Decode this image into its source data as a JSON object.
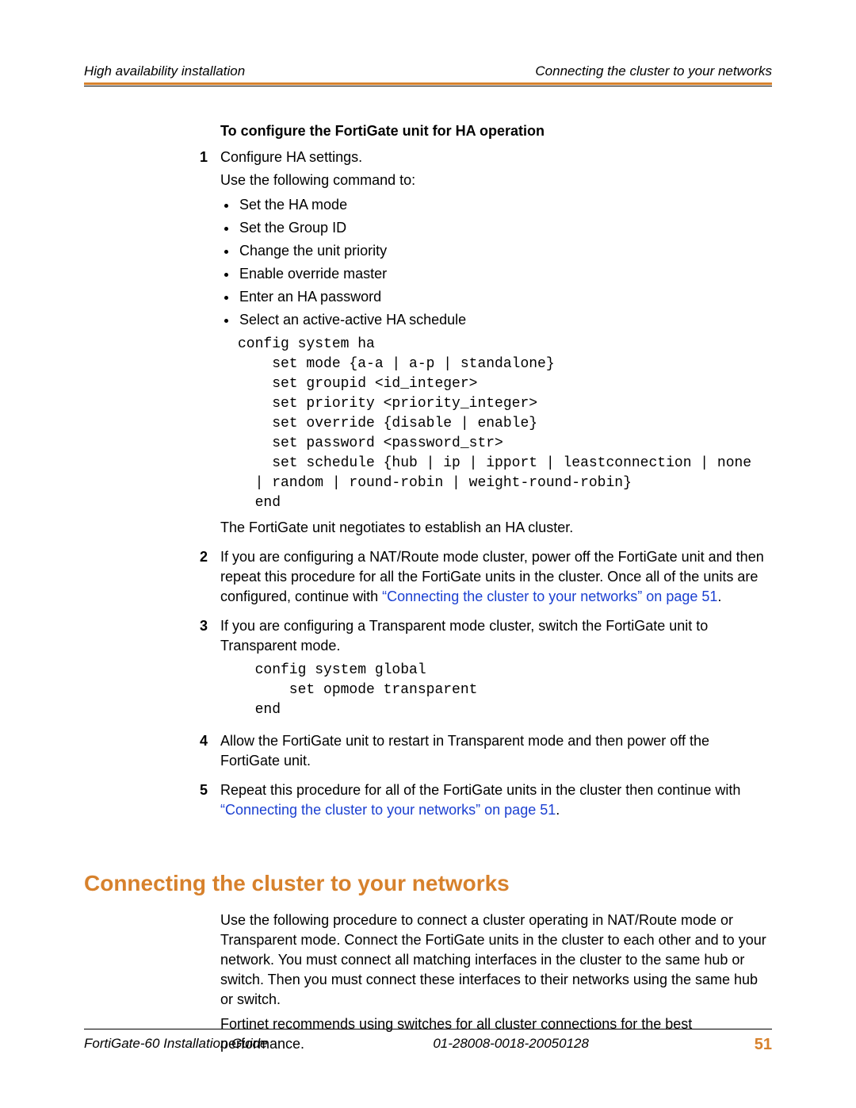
{
  "header": {
    "left": "High availability installation",
    "right": "Connecting the cluster to your networks"
  },
  "sec_title": "To configure the FortiGate unit for HA operation",
  "step1": {
    "num": "1",
    "line1": "Configure HA settings.",
    "line2": "Use the following command to:",
    "bullets": [
      "Set the HA mode",
      "Set the Group ID",
      "Change the unit priority",
      "Enable override master",
      "Enter an HA password",
      "Select an active-active HA schedule"
    ],
    "code": "config system ha\n    set mode {a-a | a-p | standalone}\n    set groupid <id_integer>\n    set priority <priority_integer>\n    set override {disable | enable}\n    set password <password_str>\n    set schedule {hub | ip | ipport | leastconnection | none \n  | random | round-robin | weight-round-robin}\n  end",
    "after": "The FortiGate unit negotiates to establish an HA cluster."
  },
  "step2": {
    "num": "2",
    "text_a": "If you are configuring a NAT/Route mode cluster, power off the FortiGate unit and then repeat this procedure for all the FortiGate units in the cluster. Once all of the units are configured, continue with ",
    "link": "“Connecting the cluster to your networks” on page 51",
    "text_b": "."
  },
  "step3": {
    "num": "3",
    "text": "If you are configuring a Transparent mode cluster, switch the FortiGate unit to Transparent mode.",
    "code": "  config system global\n      set opmode transparent\n  end"
  },
  "step4": {
    "num": "4",
    "text": "Allow the FortiGate unit to restart in Transparent mode and then power off the FortiGate unit."
  },
  "step5": {
    "num": "5",
    "text_a": "Repeat this procedure for all of the FortiGate units in the cluster then continue with ",
    "link": "“Connecting the cluster to your networks” on page 51",
    "text_b": "."
  },
  "heading": "Connecting the cluster to your networks",
  "para1": "Use the following procedure to connect a cluster operating in NAT/Route mode or Transparent mode. Connect the FortiGate units in the cluster to each other and to your network. You must connect all matching interfaces in the cluster to the same hub or switch. Then you must connect these interfaces to their networks using the same hub or switch.",
  "para2": "Fortinet recommends using switches for all cluster connections for the best performance.",
  "footer": {
    "left": "FortiGate-60 Installation Guide",
    "center": "01-28008-0018-20050128",
    "page": "51"
  }
}
